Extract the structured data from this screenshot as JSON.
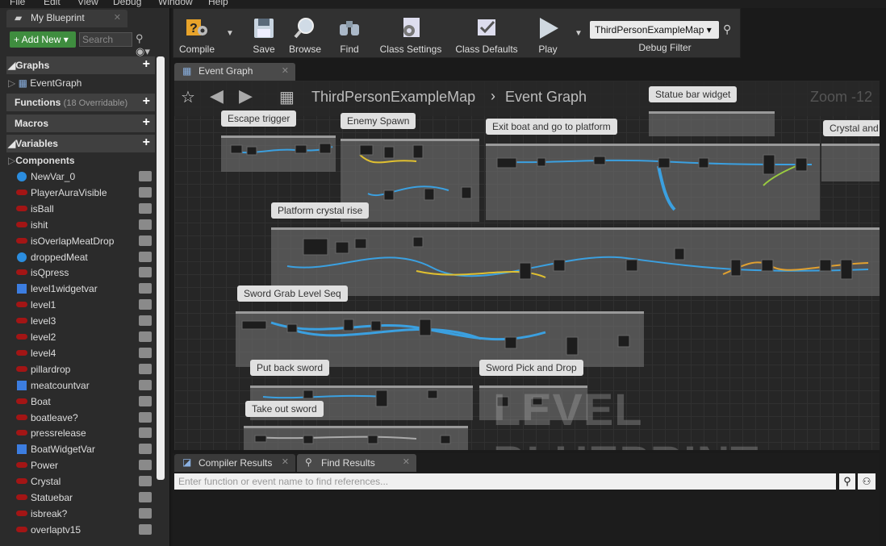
{
  "menu": [
    "File",
    "Edit",
    "View",
    "Debug",
    "Window",
    "Help"
  ],
  "panel": {
    "tab_label": "My Blueprint",
    "add_new": "+ Add New ▾",
    "search_placeholder": "Search",
    "sections": {
      "graphs": "◢Graphs",
      "functions": "Functions",
      "functions_sub": "(18 Overridable)",
      "macros": "Macros",
      "variables": "◢Variables"
    },
    "graph_item": "EventGraph",
    "components_label": "Components",
    "variables": [
      {
        "name": "NewVar_0",
        "type": "dot",
        "color": "#2b8ddf"
      },
      {
        "name": "PlayerAuraVisible",
        "type": "pill",
        "color": "#a31515"
      },
      {
        "name": "isBall",
        "type": "pill",
        "color": "#a31515"
      },
      {
        "name": "ishit",
        "type": "pill",
        "color": "#a31515"
      },
      {
        "name": "isOverlapMeatDrop",
        "type": "pill",
        "color": "#a31515"
      },
      {
        "name": "droppedMeat",
        "type": "dot",
        "color": "#2b8ddf"
      },
      {
        "name": "isQpress",
        "type": "pill",
        "color": "#a31515"
      },
      {
        "name": "level1widgetvar",
        "type": "sq",
        "color": "#3c7de0"
      },
      {
        "name": "level1",
        "type": "pill",
        "color": "#a31515"
      },
      {
        "name": "level3",
        "type": "pill",
        "color": "#a31515"
      },
      {
        "name": "level2",
        "type": "pill",
        "color": "#a31515"
      },
      {
        "name": "level4",
        "type": "pill",
        "color": "#a31515"
      },
      {
        "name": "pillardrop",
        "type": "pill",
        "color": "#a31515"
      },
      {
        "name": "meatcountvar",
        "type": "sq",
        "color": "#3c7de0"
      },
      {
        "name": "Boat",
        "type": "pill",
        "color": "#a31515"
      },
      {
        "name": "boatleave?",
        "type": "pill",
        "color": "#a31515"
      },
      {
        "name": "pressrelease",
        "type": "pill",
        "color": "#a31515"
      },
      {
        "name": "BoatWidgetVar",
        "type": "sq",
        "color": "#3c7de0"
      },
      {
        "name": "Power",
        "type": "pill",
        "color": "#a31515"
      },
      {
        "name": "Crystal",
        "type": "pill",
        "color": "#a31515"
      },
      {
        "name": "Statuebar",
        "type": "pill",
        "color": "#a31515"
      },
      {
        "name": "isbreak?",
        "type": "pill",
        "color": "#a31515"
      },
      {
        "name": "overlaptv15",
        "type": "pill",
        "color": "#a31515"
      }
    ]
  },
  "toolbar": {
    "compile": "Compile",
    "save": "Save",
    "browse": "Browse",
    "find": "Find",
    "class_settings": "Class Settings",
    "class_defaults": "Class Defaults",
    "play": "Play",
    "debug_selected": "ThirdPersonExampleMap ▾",
    "debug_filter": "Debug Filter"
  },
  "graph": {
    "tab_label": "Event Graph",
    "breadcrumb_map": "ThirdPersonExampleMap",
    "breadcrumb_graph": "Event Graph",
    "zoom": "Zoom -12",
    "watermark": "LEVEL BLUEPRINT",
    "comments": {
      "escape": "Escape trigger",
      "enemy": "Enemy Spawn",
      "exitboat": "Exit boat and go to platform",
      "statue": "Statue bar widget",
      "crystal": "Crystal and",
      "platform": "Platform crystal rise",
      "sword_grab": "Sword Grab Level Seq",
      "put_back": "Put back sword",
      "pick_drop": "Sword Pick and Drop",
      "take_out": "Take out sword"
    }
  },
  "bottom": {
    "tab_compiler": "Compiler Results",
    "tab_find": "Find Results",
    "find_placeholder": "Enter function or event name to find references..."
  }
}
